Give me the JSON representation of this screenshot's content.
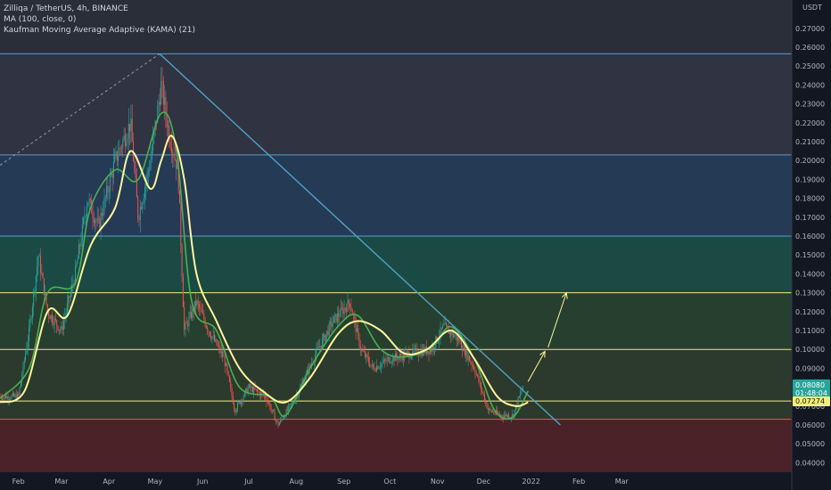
{
  "legend": {
    "symbol": "Zilliqa / TetherUS, 4h, BINANCE",
    "ma": "MA (100, close, 0)",
    "kama": "Kaufman Moving Average Adaptive (KAMA) (21)"
  },
  "colors": {
    "background": "#131722",
    "up": "#26a69a",
    "down": "#ef5350",
    "ma": "#fff59d",
    "kama": "#4caf50",
    "trendline": "#4fa3c7",
    "hline_blue": "#5b9bd5",
    "hline_yellow": "#f2ee7a",
    "hline_green": "#66bb6a",
    "price_tag": "#26a69a",
    "level_tag": "#f2ee7a"
  },
  "chart_data": {
    "type": "candlestick",
    "y_unit_label": "USDT",
    "ylim": [
      0.035,
      0.285
    ],
    "y_ticks": [
      "0.04000",
      "0.05000",
      "0.06000",
      "0.07000",
      "0.08000",
      "0.09000",
      "0.10000",
      "0.11000",
      "0.12000",
      "0.13000",
      "0.14000",
      "0.15000",
      "0.16000",
      "0.17000",
      "0.18000",
      "0.19000",
      "0.20000",
      "0.21000",
      "0.22000",
      "0.23000",
      "0.24000",
      "0.25000",
      "0.26000",
      "0.27000"
    ],
    "x_ticks": [
      "Feb",
      "Mar",
      "Apr",
      "May",
      "Jun",
      "Jul",
      "Aug",
      "Sep",
      "Oct",
      "Nov",
      "Dec",
      "2022",
      "Feb",
      "Mar"
    ],
    "current_price": "0.08080",
    "countdown": "01:48:04",
    "level_price": "0.07274",
    "price_path": [
      {
        "date": "2021-01-20",
        "price": 0.075
      },
      {
        "date": "2021-02-01",
        "price": 0.075
      },
      {
        "date": "2021-02-08",
        "price": 0.11
      },
      {
        "date": "2021-02-14",
        "price": 0.15
      },
      {
        "date": "2021-02-20",
        "price": 0.12
      },
      {
        "date": "2021-03-01",
        "price": 0.11
      },
      {
        "date": "2021-03-10",
        "price": 0.14
      },
      {
        "date": "2021-03-18",
        "price": 0.18
      },
      {
        "date": "2021-03-25",
        "price": 0.165
      },
      {
        "date": "2021-04-05",
        "price": 0.2
      },
      {
        "date": "2021-04-15",
        "price": 0.22
      },
      {
        "date": "2021-04-20",
        "price": 0.17
      },
      {
        "date": "2021-04-28",
        "price": 0.2
      },
      {
        "date": "2021-05-05",
        "price": 0.24
      },
      {
        "date": "2021-05-10",
        "price": 0.215
      },
      {
        "date": "2021-05-16",
        "price": 0.195
      },
      {
        "date": "2021-05-20",
        "price": 0.11
      },
      {
        "date": "2021-05-28",
        "price": 0.125
      },
      {
        "date": "2021-06-05",
        "price": 0.11
      },
      {
        "date": "2021-06-15",
        "price": 0.095
      },
      {
        "date": "2021-06-22",
        "price": 0.068
      },
      {
        "date": "2021-07-01",
        "price": 0.08
      },
      {
        "date": "2021-07-12",
        "price": 0.075
      },
      {
        "date": "2021-07-20",
        "price": 0.06
      },
      {
        "date": "2021-08-01",
        "price": 0.075
      },
      {
        "date": "2021-08-15",
        "price": 0.1
      },
      {
        "date": "2021-08-25",
        "price": 0.115
      },
      {
        "date": "2021-09-05",
        "price": 0.125
      },
      {
        "date": "2021-09-12",
        "price": 0.1
      },
      {
        "date": "2021-09-20",
        "price": 0.09
      },
      {
        "date": "2021-10-01",
        "price": 0.095
      },
      {
        "date": "2021-10-15",
        "price": 0.098
      },
      {
        "date": "2021-10-28",
        "price": 0.1
      },
      {
        "date": "2021-11-05",
        "price": 0.112
      },
      {
        "date": "2021-11-15",
        "price": 0.105
      },
      {
        "date": "2021-11-25",
        "price": 0.09
      },
      {
        "date": "2021-12-04",
        "price": 0.068
      },
      {
        "date": "2021-12-12",
        "price": 0.065
      },
      {
        "date": "2021-12-20",
        "price": 0.065
      },
      {
        "date": "2021-12-27",
        "price": 0.081
      }
    ],
    "ma_path": [
      {
        "date": "2021-01-20",
        "price": 0.072
      },
      {
        "date": "2021-02-05",
        "price": 0.078
      },
      {
        "date": "2021-02-20",
        "price": 0.12
      },
      {
        "date": "2021-03-05",
        "price": 0.118
      },
      {
        "date": "2021-03-20",
        "price": 0.155
      },
      {
        "date": "2021-04-05",
        "price": 0.175
      },
      {
        "date": "2021-04-15",
        "price": 0.205
      },
      {
        "date": "2021-04-28",
        "price": 0.185
      },
      {
        "date": "2021-05-05",
        "price": 0.2
      },
      {
        "date": "2021-05-12",
        "price": 0.213
      },
      {
        "date": "2021-05-20",
        "price": 0.19
      },
      {
        "date": "2021-05-28",
        "price": 0.14
      },
      {
        "date": "2021-06-10",
        "price": 0.115
      },
      {
        "date": "2021-06-25",
        "price": 0.09
      },
      {
        "date": "2021-07-10",
        "price": 0.078
      },
      {
        "date": "2021-07-25",
        "price": 0.072
      },
      {
        "date": "2021-08-10",
        "price": 0.085
      },
      {
        "date": "2021-08-28",
        "price": 0.108
      },
      {
        "date": "2021-09-10",
        "price": 0.115
      },
      {
        "date": "2021-09-25",
        "price": 0.11
      },
      {
        "date": "2021-10-10",
        "price": 0.098
      },
      {
        "date": "2021-10-25",
        "price": 0.1
      },
      {
        "date": "2021-11-10",
        "price": 0.11
      },
      {
        "date": "2021-11-25",
        "price": 0.095
      },
      {
        "date": "2021-12-10",
        "price": 0.075
      },
      {
        "date": "2021-12-22",
        "price": 0.07
      },
      {
        "date": "2021-12-30",
        "price": 0.072
      }
    ],
    "kama_path": [
      {
        "date": "2021-01-20",
        "price": 0.074
      },
      {
        "date": "2021-02-08",
        "price": 0.09
      },
      {
        "date": "2021-02-20",
        "price": 0.13
      },
      {
        "date": "2021-03-10",
        "price": 0.135
      },
      {
        "date": "2021-03-20",
        "price": 0.175
      },
      {
        "date": "2021-04-05",
        "price": 0.195
      },
      {
        "date": "2021-04-20",
        "price": 0.19
      },
      {
        "date": "2021-05-05",
        "price": 0.225
      },
      {
        "date": "2021-05-15",
        "price": 0.205
      },
      {
        "date": "2021-05-25",
        "price": 0.125
      },
      {
        "date": "2021-06-10",
        "price": 0.11
      },
      {
        "date": "2021-06-25",
        "price": 0.08
      },
      {
        "date": "2021-07-15",
        "price": 0.075
      },
      {
        "date": "2021-07-25",
        "price": 0.065
      },
      {
        "date": "2021-08-10",
        "price": 0.09
      },
      {
        "date": "2021-08-28",
        "price": 0.112
      },
      {
        "date": "2021-09-10",
        "price": 0.118
      },
      {
        "date": "2021-09-25",
        "price": 0.1
      },
      {
        "date": "2021-10-10",
        "price": 0.096
      },
      {
        "date": "2021-10-28",
        "price": 0.101
      },
      {
        "date": "2021-11-10",
        "price": 0.112
      },
      {
        "date": "2021-11-25",
        "price": 0.095
      },
      {
        "date": "2021-12-08",
        "price": 0.068
      },
      {
        "date": "2021-12-20",
        "price": 0.064
      },
      {
        "date": "2021-12-30",
        "price": 0.078
      }
    ],
    "horizontal_levels": [
      {
        "price": 0.2565,
        "color": "#5b9bd5"
      },
      {
        "price": 0.203,
        "color": "#5b9bd5"
      },
      {
        "price": 0.16,
        "color": "#5b9bd5"
      },
      {
        "price": 0.13,
        "color": "#f2ee7a"
      },
      {
        "price": 0.1,
        "color": "#f2ee7a"
      },
      {
        "price": 0.0727,
        "color": "#f2ee7a"
      },
      {
        "price": 0.063,
        "color": "#ef5350"
      }
    ],
    "zones": [
      {
        "from": 0.2565,
        "to": 0.285,
        "color": "#2a2e39"
      },
      {
        "from": 0.203,
        "to": 0.2565,
        "color": "#2f3342"
      },
      {
        "from": 0.16,
        "to": 0.203,
        "color": "#253a55"
      },
      {
        "from": 0.13,
        "to": 0.16,
        "color": "#1b4a45"
      },
      {
        "from": 0.1,
        "to": 0.13,
        "color": "#263f2f"
      },
      {
        "from": 0.0727,
        "to": 0.1,
        "color": "#2b3a2c"
      },
      {
        "from": 0.063,
        "to": 0.0727,
        "color": "#2b3a2c"
      },
      {
        "from": 0.035,
        "to": 0.063,
        "color": "#4a2228"
      }
    ],
    "trendline": {
      "from": {
        "date": "2021-05-04",
        "price": 0.2565
      },
      "to": {
        "date": "2022-01-20",
        "price": 0.06
      }
    },
    "dashed_line": {
      "from": {
        "date": "2021-01-20",
        "price": 0.1975
      },
      "to": {
        "date": "2021-05-04",
        "price": 0.2565
      }
    },
    "forecast_arrows": [
      {
        "from": {
          "date": "2021-12-30",
          "price": 0.083
        },
        "to": {
          "date": "2022-01-10",
          "price": 0.099
        }
      },
      {
        "from": {
          "date": "2022-01-12",
          "price": 0.101
        },
        "to": {
          "date": "2022-01-24",
          "price": 0.13
        }
      }
    ]
  }
}
